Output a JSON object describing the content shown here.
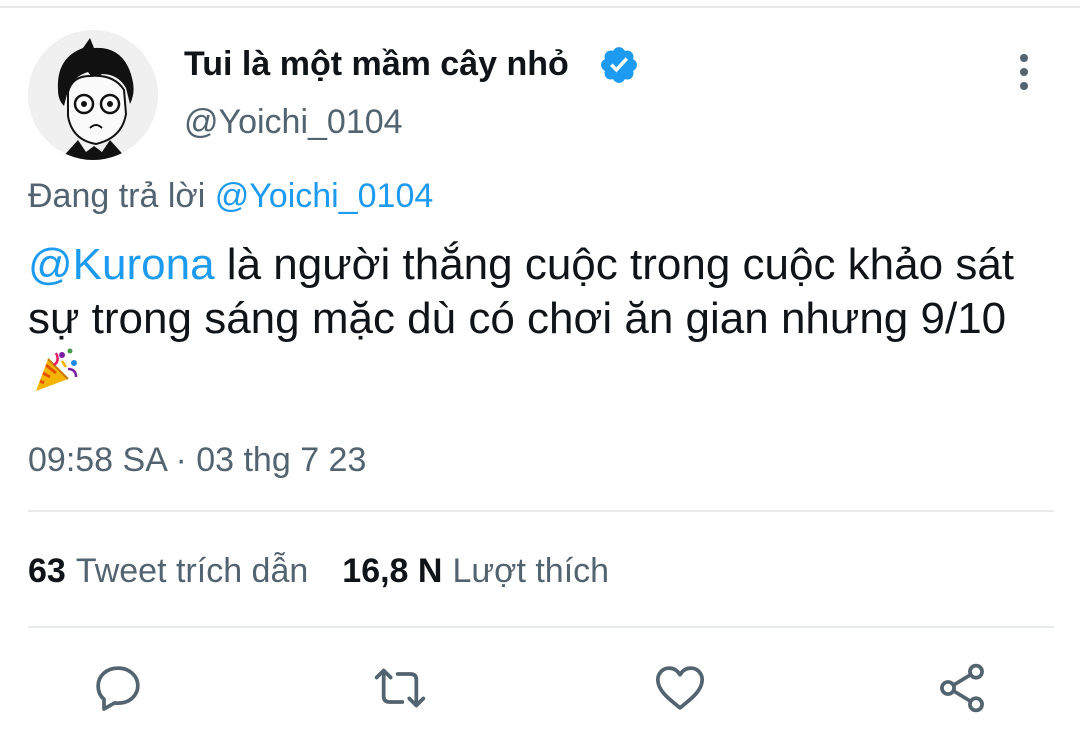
{
  "tweet": {
    "author_name": "Tui là một mầm cây nhỏ",
    "handle": "@Yoichi_0104",
    "verified": true,
    "reply_prefix": "Đang trả lời",
    "reply_to": "@Yoichi_0104",
    "mention": "@Kurona",
    "text_after_mention": " là người thắng cuộc trong cuộc khảo sát sự trong sáng mặc dù có chơi ăn gian nhưng 9/10",
    "emoji": "party-popper",
    "timestamp": "09:58 SA · 03 thg 7 23"
  },
  "stats": {
    "quote_count": "63",
    "quote_label": "Tweet trích dẫn",
    "like_count": "16,8 N",
    "like_label": "Lượt thích"
  },
  "actions": [
    {
      "icon": "reply-icon"
    },
    {
      "icon": "retweet-icon"
    },
    {
      "icon": "like-icon"
    },
    {
      "icon": "share-icon"
    }
  ],
  "colors": {
    "accent": "#1d9bf0",
    "secondary_text": "#536471",
    "primary_text": "#0f1419"
  }
}
